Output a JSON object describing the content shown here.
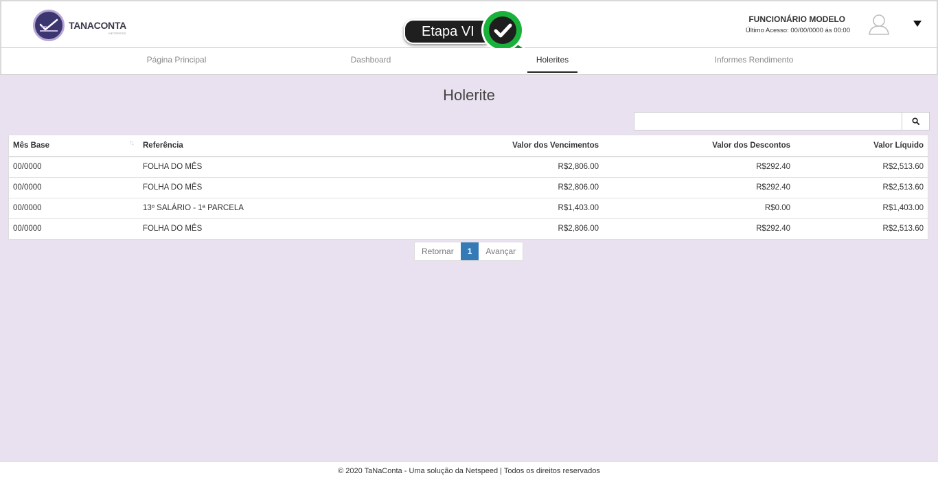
{
  "header": {
    "brand": "TANACONTA",
    "brand_sub": "NETSPEED",
    "step_label": "Etapa VI",
    "user_name": "FUNCIONÁRIO MODELO",
    "last_access": "Último Acesso: 00/00/0000 ás 00:00"
  },
  "nav": {
    "items": [
      {
        "label": "Página Principal"
      },
      {
        "label": "Dashboard"
      },
      {
        "label": "Holerites"
      },
      {
        "label": "Informes Rendimento"
      }
    ],
    "active": "Holerites"
  },
  "main": {
    "title": "Holerite",
    "search": {
      "value": "",
      "placeholder": ""
    },
    "table": {
      "columns": [
        "Mês Base",
        "Referência",
        "Valor dos Vencimentos",
        "Valor dos Descontos",
        "Valor Líquido"
      ],
      "rows": [
        [
          "00/0000",
          "FOLHA DO MÊS",
          "R$2,806.00",
          "R$292.40",
          "R$2,513.60"
        ],
        [
          "00/0000",
          "FOLHA DO MÊS",
          "R$2,806.00",
          "R$292.40",
          "R$2,513.60"
        ],
        [
          "00/0000",
          "13º SALÁRIO - 1ª PARCELA",
          "R$1,403.00",
          "R$0.00",
          "R$1,403.00"
        ],
        [
          "00/0000",
          "FOLHA DO MÊS",
          "R$2,806.00",
          "R$292.40",
          "R$2,513.60"
        ]
      ]
    },
    "pagination": {
      "prev": "Retornar",
      "current": "1",
      "next": "Avançar"
    }
  },
  "footer": {
    "text": "© 2020 TaNaConta - Uma solução da Netspeed | Todos os direitos reservados"
  },
  "icons": {
    "search": "search-icon",
    "user": "user-icon",
    "check": "check-badge-icon",
    "caret": "caret-down-icon",
    "sort": "sort-icon"
  },
  "colors": {
    "background": "#e9e1f0",
    "accent": "#337ab7",
    "brand": "#3c3670",
    "badge_green": "#18b23a"
  }
}
